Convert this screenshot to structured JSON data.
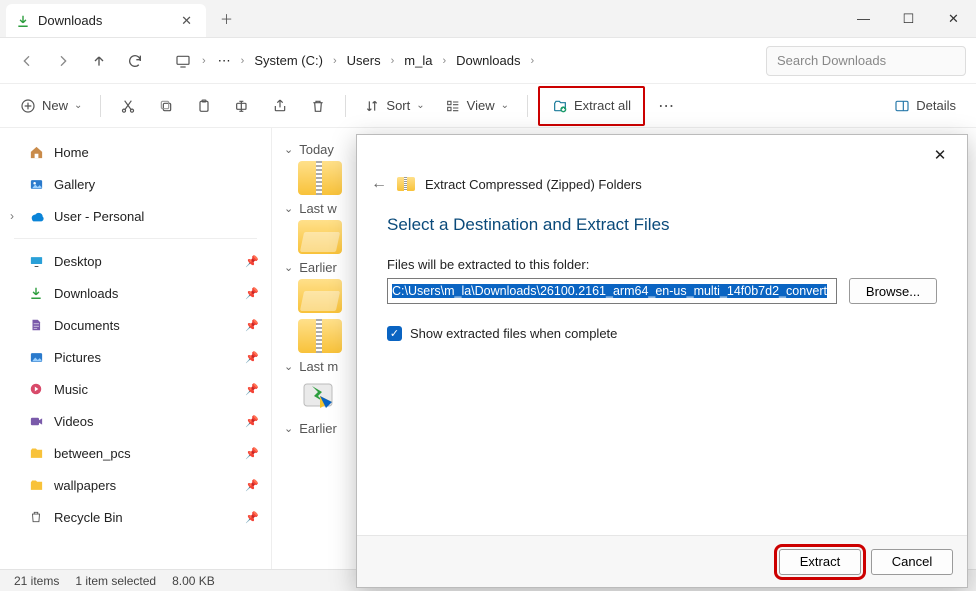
{
  "window": {
    "tab_title": "Downloads",
    "new_tab_tooltip": "New tab"
  },
  "nav": {
    "crumbs": [
      "System (C:)",
      "Users",
      "m_la",
      "Downloads"
    ],
    "search_placeholder": "Search Downloads"
  },
  "toolbar": {
    "new_label": "New",
    "sort_label": "Sort",
    "view_label": "View",
    "extract_all_label": "Extract all",
    "details_label": "Details"
  },
  "sidebar": {
    "top": [
      {
        "label": "Home",
        "icon": "home"
      },
      {
        "label": "Gallery",
        "icon": "gallery"
      },
      {
        "label": "User - Personal",
        "icon": "onedrive",
        "expandable": true
      }
    ],
    "pinned": [
      {
        "label": "Desktop",
        "icon": "desktop"
      },
      {
        "label": "Downloads",
        "icon": "downloads"
      },
      {
        "label": "Documents",
        "icon": "documents"
      },
      {
        "label": "Pictures",
        "icon": "pictures"
      },
      {
        "label": "Music",
        "icon": "music"
      },
      {
        "label": "Videos",
        "icon": "videos"
      },
      {
        "label": "between_pcs",
        "icon": "folder"
      },
      {
        "label": "wallpapers",
        "icon": "folder"
      },
      {
        "label": "Recycle Bin",
        "icon": "recycle"
      }
    ]
  },
  "content": {
    "groups": [
      "Today",
      "Last w",
      "Earlier",
      "Last m",
      "Earlier"
    ]
  },
  "status": {
    "item_count": "21 items",
    "selection": "1 item selected",
    "size": "8.00 KB"
  },
  "dialog": {
    "wizard_title": "Extract Compressed (Zipped) Folders",
    "heading": "Select a Destination and Extract Files",
    "dest_label": "Files will be extracted to this folder:",
    "dest_path": "C:\\Users\\m_la\\Downloads\\26100.2161_arm64_en-us_multi_14f0b7d2_convert",
    "browse_label": "Browse...",
    "checkbox_label": "Show extracted files when complete",
    "checkbox_checked": true,
    "extract_label": "Extract",
    "cancel_label": "Cancel"
  }
}
